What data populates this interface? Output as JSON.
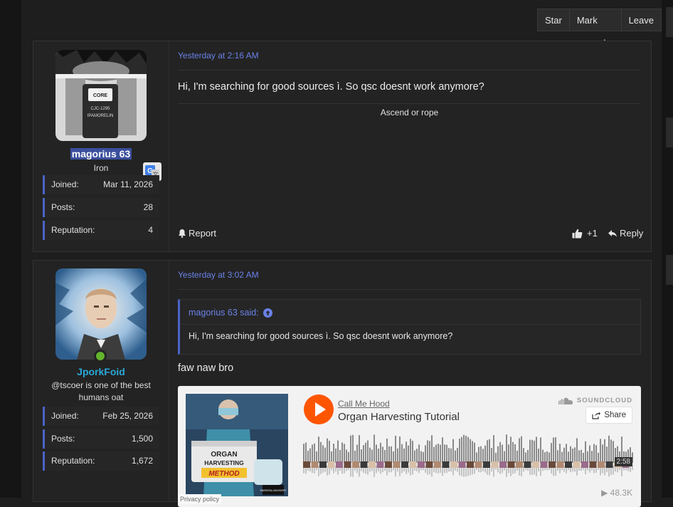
{
  "thread_actions": {
    "star": "Star",
    "mark_unread": "Mark unread",
    "leave": "Leave"
  },
  "colors": {
    "accent": "#6a82e8",
    "online": "#62b32e",
    "username2": "#2aa8d8",
    "soundcloud": "#ff5500"
  },
  "posts": [
    {
      "username": "magorius 63",
      "user_title": "Iron",
      "stats": [
        {
          "label": "Joined:",
          "value": "Mar 11, 2026"
        },
        {
          "label": "Posts:",
          "value": "28"
        },
        {
          "label": "Reputation:",
          "value": "4"
        }
      ],
      "date": "Yesterday at 2:16 AM",
      "body": "Hi, I'm searching for good sources ì. So qsc doesnt work anymore?",
      "signature": "Ascend or rope",
      "report_label": "Report",
      "reaction_count": "+1",
      "reply_label": "Reply"
    },
    {
      "username": "JporkFoid",
      "user_title_line1": "@tscoer is one of the best",
      "user_title_line2": "humans oat",
      "stats": [
        {
          "label": "Joined:",
          "value": "Feb 25, 2026"
        },
        {
          "label": "Posts:",
          "value": "1,500"
        },
        {
          "label": "Reputation:",
          "value": "1,672"
        }
      ],
      "date": "Yesterday at 3:02 AM",
      "quote_author": "magorius 63 said:",
      "quote_body": "Hi, I'm searching for good sources ì. So qsc doesnt work anymore?",
      "body": "faw naw bro",
      "embed": {
        "artist": "Call Me Hood",
        "track": "Organ Harvesting Tutorial",
        "brand": "SOUNDCLOUD",
        "share_label": "Share",
        "duration": "2:58",
        "plays": "48.3K",
        "privacy": "Privacy policy",
        "art_line1": "ORGAN",
        "art_line2": "HARVESTING",
        "art_line3": "METHOD",
        "art_badge": "PARENTAL ADVISORY"
      }
    }
  ]
}
